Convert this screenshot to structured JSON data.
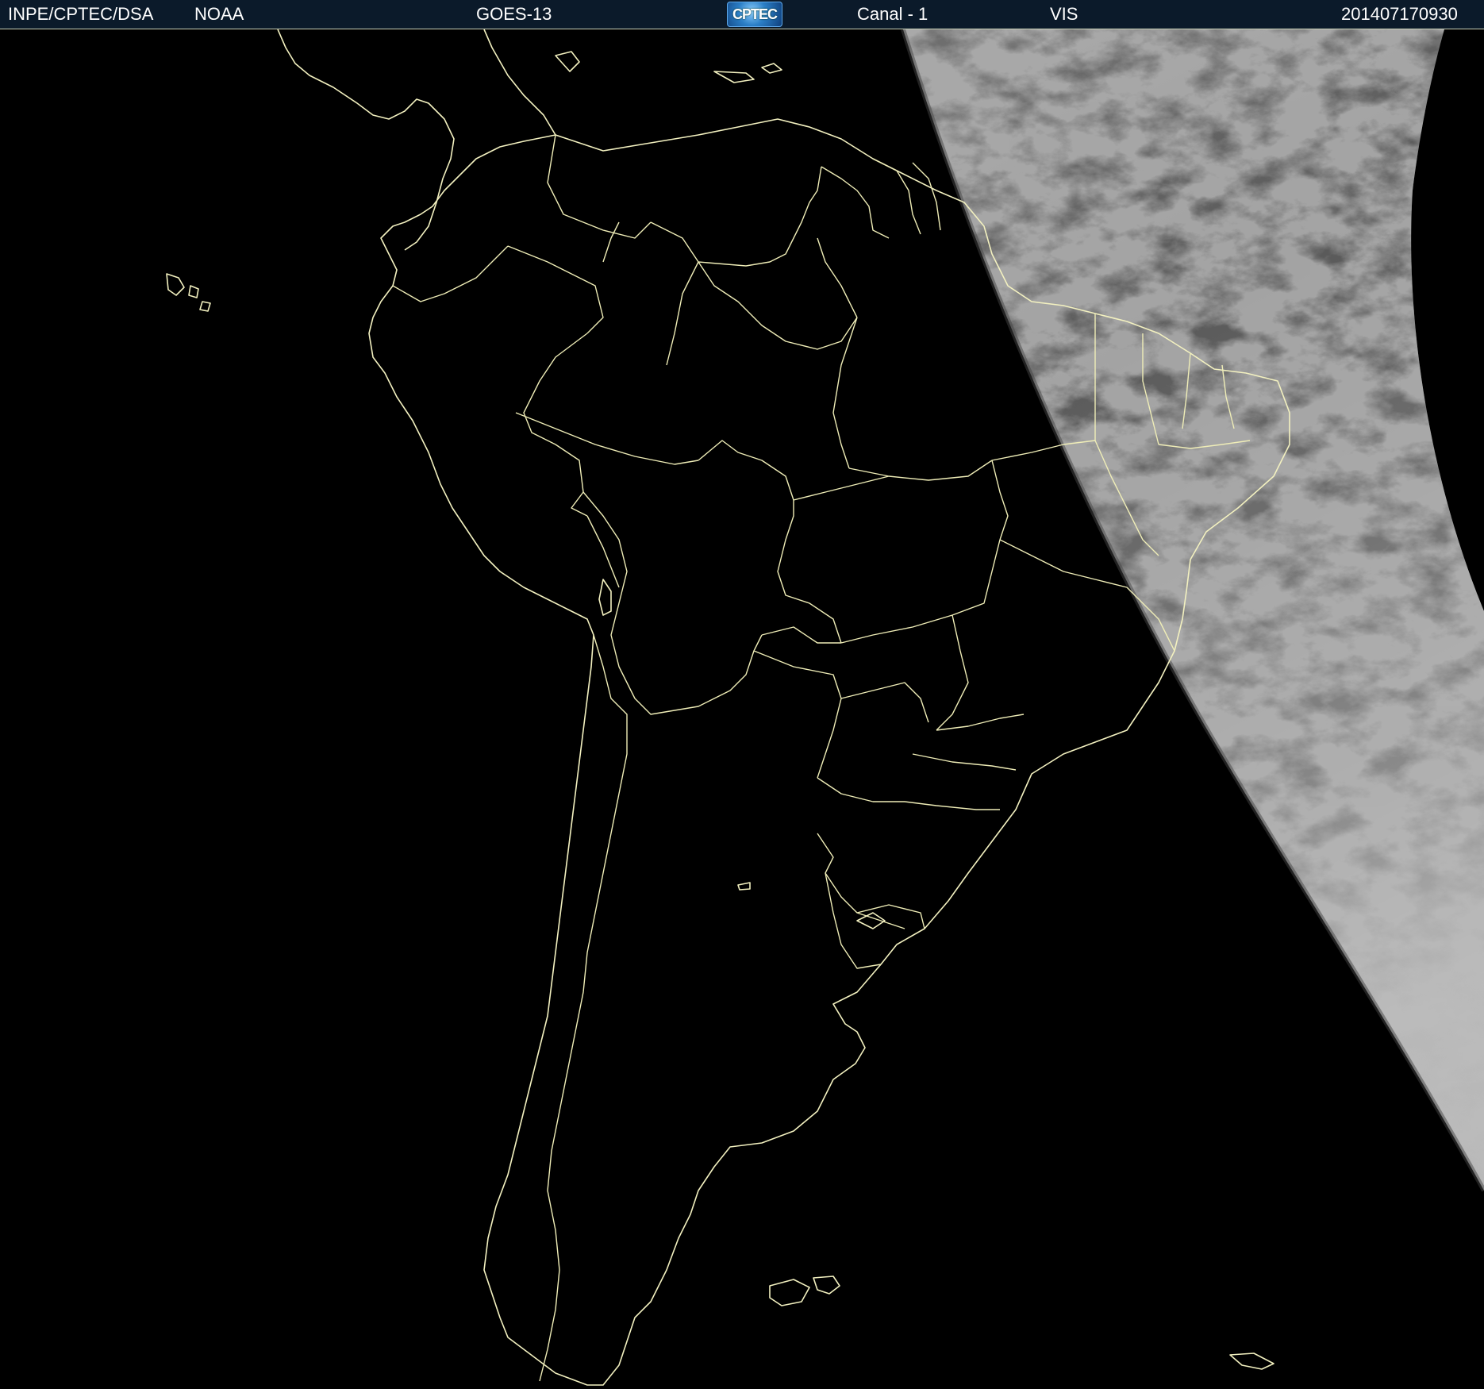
{
  "header": {
    "organization": "INPE/CPTEC/DSA",
    "agency": "NOAA",
    "satellite": "GOES-13",
    "logo_text": "CPTEC",
    "channel": "Canal - 1",
    "band": "VIS",
    "timestamp": "201407170930"
  },
  "colors": {
    "header_background": "#0b1a2a",
    "border_lines": "#efedb7",
    "night_side": "#000000",
    "day_side": "#8a8a8a"
  },
  "icons": {
    "logo": "cptec-logo-icon"
  }
}
